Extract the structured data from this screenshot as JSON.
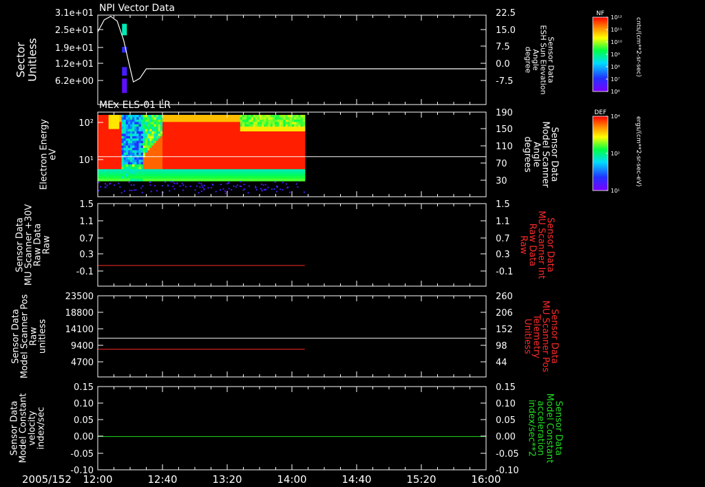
{
  "colors": {
    "white": "#ffffff",
    "red": "#ff2a2a",
    "green": "#22dd22",
    "black": "#000000"
  },
  "footer": {
    "date": "2005/152"
  },
  "time_axis": {
    "tick_labels": [
      "12:00",
      "12:40",
      "13:20",
      "14:00",
      "14:40",
      "15:20",
      "16:00"
    ]
  },
  "colorbars": [
    {
      "name": "nf",
      "label": "NF",
      "unit": "cnts/(cm**2-sr-sec)",
      "tick_labels": [
        "10¹²",
        "10¹¹",
        "10¹⁰",
        "10⁹",
        "10⁸",
        "10⁷",
        "10⁶"
      ],
      "min_exp": 6,
      "max_exp": 12
    },
    {
      "name": "def",
      "label": "DEF",
      "unit": "ergs/(cm**2-sr-sec-eV)",
      "tick_labels": [
        "10⁴",
        "10²",
        "10¹"
      ],
      "min_exp": 1,
      "max_exp": 4
    }
  ],
  "chart_data": [
    {
      "type": "heatmap",
      "title": "NPI Vector Data",
      "ylabel": [
        "Sector",
        "Unitless"
      ],
      "y_tick_labels": [
        "3.1e+01",
        "2.5e+01",
        "1.9e+01",
        "1.2e+01",
        "6.2e+00"
      ],
      "right_ylabel": [
        "Sensor Data",
        "ESH Sun Elevation",
        "Angle",
        "degree"
      ],
      "right_tick_labels": [
        "22.5",
        "15.0",
        "7.5",
        "0.0",
        "-7.5"
      ],
      "ylim": [
        0,
        31
      ],
      "right_ylim": [
        -15,
        22.5
      ],
      "xlim_minutes": [
        0,
        240
      ],
      "heat_blocks": [
        {
          "t0": 15,
          "t1": 18,
          "y0": 24,
          "y1": 28,
          "level": 0.45
        },
        {
          "t0": 15,
          "t1": 18,
          "y0": 18,
          "y1": 20,
          "level": 0.15
        },
        {
          "t0": 15,
          "t1": 18,
          "y0": 10,
          "y1": 13,
          "level": 0.1
        },
        {
          "t0": 15,
          "t1": 18,
          "y0": 4,
          "y1": 9,
          "level": 0.05
        }
      ],
      "line": {
        "name": "ESH Sun Elevation",
        "color": "#ffffff",
        "t": [
          0,
          4,
          8,
          12,
          16,
          19,
          22,
          26,
          30,
          40,
          60,
          100,
          140,
          180,
          240
        ],
        "v": [
          15.5,
          20.5,
          22,
          20,
          12,
          3,
          -5.5,
          -4,
          0,
          0,
          0,
          0,
          0,
          0,
          0
        ]
      }
    },
    {
      "type": "heatmap",
      "title": "MEx ELS-01 LR",
      "ylabel": [
        "Electron Energy",
        "eV"
      ],
      "y_tick_labels": [
        "10²",
        "10¹"
      ],
      "right_ylabel": [
        "Sensor Data",
        "Model Scanner",
        "Angle",
        "degrees"
      ],
      "right_tick_labels": [
        "190",
        "150",
        "110",
        "70",
        "30"
      ],
      "ylim_log10": [
        0.2,
        2.15
      ],
      "right_ylim": [
        0,
        190
      ],
      "data_end_minutes": 128,
      "line": {
        "name": "Model Scanner Angle",
        "color": "#ffffff",
        "value": 90
      }
    },
    {
      "type": "line",
      "ylabel": [
        "Sensor Data",
        "MU Scanner +30V",
        "Raw Data",
        "Raw"
      ],
      "y_tick_labels": [
        "1.5",
        "1.1",
        "0.7",
        "0.3",
        "-0.1"
      ],
      "right_ylabel": [
        "Sensor Data",
        "MU Scanner Int",
        "Raw Data",
        "Raw"
      ],
      "right_tick_labels": [
        "1.5",
        "1.1",
        "0.7",
        "0.3",
        "-0.1"
      ],
      "ylim": [
        -0.5,
        1.5
      ],
      "series": [
        {
          "color": "#ff2a2a",
          "t": [
            0,
            128
          ],
          "v": [
            0,
            0
          ]
        }
      ]
    },
    {
      "type": "line",
      "ylabel": [
        "Sensor Data",
        "Model Scanner Pos",
        "Raw",
        "unitless"
      ],
      "y_tick_labels": [
        "23500",
        "18800",
        "14100",
        "9400",
        "4700"
      ],
      "right_ylabel": [
        "Sensor Data",
        "MU Scanner Pos",
        "Telemetry",
        "Unitless"
      ],
      "right_tick_labels": [
        "260",
        "206",
        "152",
        "98",
        "44"
      ],
      "ylim": [
        0,
        23500
      ],
      "right_ylim": [
        -10,
        260
      ],
      "series": [
        {
          "color": "#ffffff",
          "t": [
            0,
            240
          ],
          "v": [
            11200,
            11200
          ]
        },
        {
          "color": "#ff2a2a",
          "t": [
            0,
            128
          ],
          "v": [
            8000,
            8000
          ]
        }
      ]
    },
    {
      "type": "line",
      "ylabel": [
        "Sensor Data",
        "Model Constant",
        "velocity",
        "index/sec"
      ],
      "y_tick_labels": [
        "0.15",
        "0.10",
        "0.05",
        "0.00",
        "-0.05",
        "-0.10"
      ],
      "right_ylabel": [
        "Sensor Data",
        "Model Constant",
        "acceleration",
        "index/sec**2"
      ],
      "right_tick_labels": [
        "0.15",
        "0.10",
        "0.05",
        "0.00",
        "-0.05",
        "-0.10"
      ],
      "ylim": [
        -0.1,
        0.15
      ],
      "series": [
        {
          "color": "#22dd22",
          "t": [
            0,
            240
          ],
          "v": [
            0,
            0
          ]
        }
      ]
    }
  ]
}
